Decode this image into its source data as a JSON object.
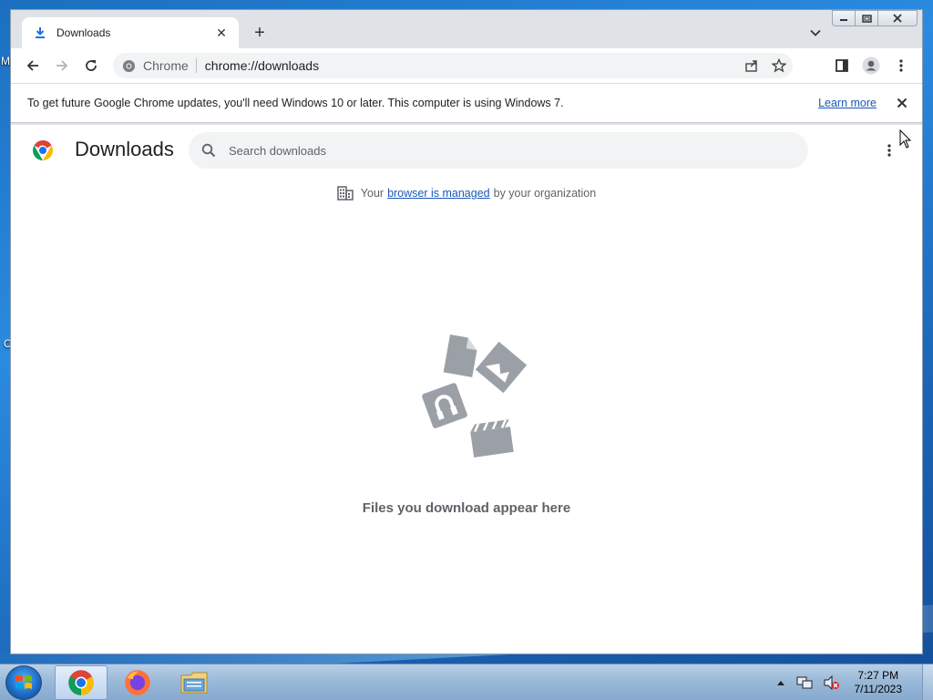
{
  "desktop": {
    "letter_m": "M",
    "letter_c": "C"
  },
  "tab": {
    "title": "Downloads",
    "close": "✕",
    "new_tab": "+"
  },
  "omnibox": {
    "chip": "Chrome",
    "url": "chrome://downloads"
  },
  "infobar": {
    "message": "To get future Google Chrome updates, you'll need Windows 10 or later. This computer is using Windows 7.",
    "link": "Learn more"
  },
  "page": {
    "title": "Downloads",
    "search_placeholder": "Search downloads",
    "managed_prefix": "Your",
    "managed_link": "browser is managed",
    "managed_suffix": "by your organization",
    "empty_message": "Files you download appear here"
  },
  "taskbar": {
    "apps": [
      "chrome",
      "firefox",
      "file-explorer"
    ],
    "time": "7:27 PM",
    "date": "7/11/2023"
  },
  "colors": {
    "accent": "#1a73e8",
    "link": "#1a57b8",
    "illustration": "#9aa0a6"
  }
}
